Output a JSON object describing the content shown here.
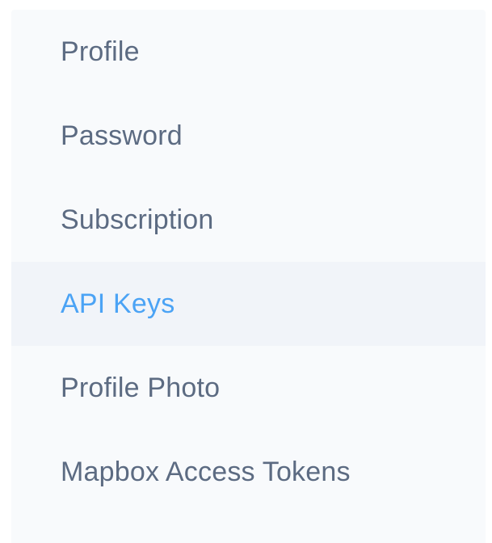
{
  "settings_nav": {
    "items": [
      {
        "label": "Profile",
        "active": false
      },
      {
        "label": "Password",
        "active": false
      },
      {
        "label": "Subscription",
        "active": false
      },
      {
        "label": "API Keys",
        "active": true
      },
      {
        "label": "Profile Photo",
        "active": false
      },
      {
        "label": "Mapbox Access Tokens",
        "active": false
      }
    ],
    "colors": {
      "text": "#5c6b82",
      "active_text": "#4ba3f5",
      "panel_bg": "#f8fafc",
      "active_bg": "#f1f4f9"
    }
  }
}
